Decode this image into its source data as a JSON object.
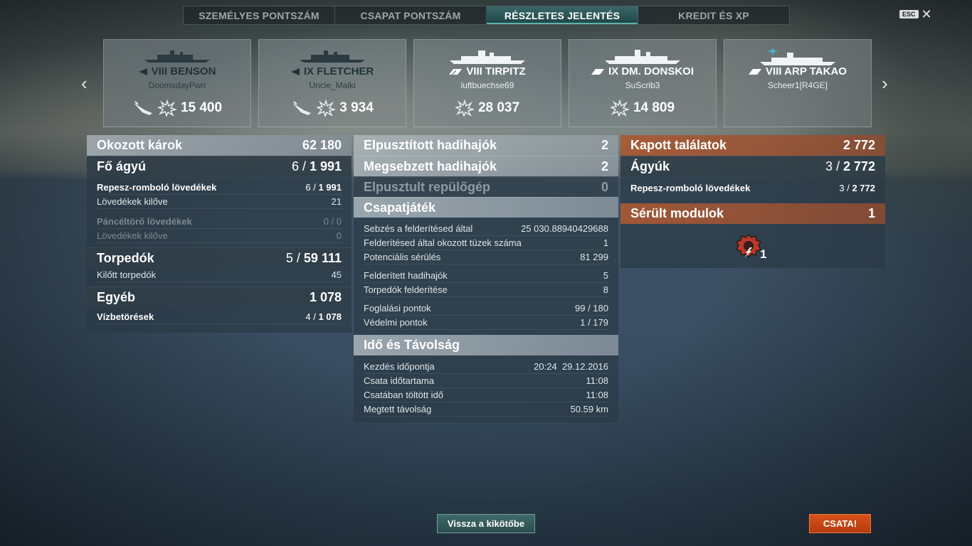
{
  "tabs": [
    {
      "label": "SZEMÉLYES PONTSZÁM"
    },
    {
      "label": "CSAPAT PONTSZÁM"
    },
    {
      "label": "RÉSZLETES JELENTÉS"
    },
    {
      "label": "KREDIT ÉS XP"
    }
  ],
  "active_tab": 2,
  "esc_label": "ESC",
  "ships": [
    {
      "name": "VIII BENSON",
      "player": "DoomsdayPwn",
      "damage": "15 400",
      "side": "enemy",
      "icons": [
        "torpedo-hit-icon",
        "explosion-icon"
      ]
    },
    {
      "name": "IX FLETCHER",
      "player": "Uncle_Malki",
      "damage": "3 934",
      "side": "enemy",
      "icons": [
        "torpedo-hit-icon",
        "explosion-icon"
      ]
    },
    {
      "name": "VIII TIRPITZ",
      "player": "luftbuechse69",
      "damage": "28 037",
      "side": "ally",
      "icons": [
        "explosion-icon"
      ]
    },
    {
      "name": "IX DM. DONSKOI",
      "player": "SuScrib3",
      "damage": "14 809",
      "side": "ally",
      "icons": [
        "explosion-icon"
      ]
    },
    {
      "name": "VIII ARP TAKAO",
      "player": "Scheer1[R4GE]",
      "damage": "",
      "side": "ally",
      "icons": []
    }
  ],
  "damage_panel": {
    "header": {
      "label": "Okozott károk",
      "value": "62 180"
    },
    "main_gun": {
      "label": "Fő ágyú",
      "value_a": "6 / ",
      "value_b": "1 991"
    },
    "he_shells": {
      "label": "Repesz-romboló lövedékek",
      "value_a": "6 / ",
      "value_b": "1 991"
    },
    "shells_fired": {
      "label": "Lövedékek kilőve",
      "value": "21"
    },
    "ap_shells": {
      "label": "Páncéltörő lövedékek",
      "value": "0 / 0"
    },
    "ap_fired": {
      "label": "Lövedékek kilőve",
      "value": "0"
    },
    "torpedoes": {
      "label": "Torpedók",
      "value_a": "5 / ",
      "value_b": "59 111"
    },
    "torps_fired": {
      "label": "Kilőtt torpedók",
      "value": "45"
    },
    "other": {
      "label": "Egyéb",
      "value": "1 078"
    },
    "flooding": {
      "label": "Vízbetörések",
      "value_a": "4 / ",
      "value_b": "1 078"
    }
  },
  "kills_panel": {
    "destroyed": {
      "label": "Elpusztított hadihajók",
      "value": "2"
    },
    "damaged": {
      "label": "Megsebzett hadihajók",
      "value": "2"
    },
    "planes": {
      "label": "Elpusztult repülőgép",
      "value": "0"
    },
    "teamplay_title": "Csapatjáték",
    "teamplay_rows": [
      {
        "label": "Sebzés a felderítésed által",
        "value": "25 030.88940429688"
      },
      {
        "label": "Felderítésed által okozott tüzek száma",
        "value": "1"
      },
      {
        "label": "Potenciális sérülés",
        "value": "81 299"
      },
      {
        "label": "Felderített hadihajók",
        "value": "5"
      },
      {
        "label": "Torpedók felderítése",
        "value": "8"
      },
      {
        "label": "Foglalási pontok",
        "value": "99 / 180"
      },
      {
        "label": "Védelmi pontok",
        "value": "1 / 179"
      }
    ],
    "time_title": "Idő és Távolság",
    "time_rows": [
      {
        "label": "Kezdés időpontja",
        "value": "20:24  29.12.2016"
      },
      {
        "label": "Csata időtartama",
        "value": "11:08"
      },
      {
        "label": "Csatában töltött idő",
        "value": "11:08"
      },
      {
        "label": "Megtett távolság",
        "value": "50.59 km"
      }
    ]
  },
  "received_panel": {
    "header": {
      "label": "Kapott találatok",
      "value": "2 772"
    },
    "guns": {
      "label": "Ágyúk",
      "value_a": "3 / ",
      "value_b": "2 772"
    },
    "he": {
      "label": "Repesz-romboló lövedékek",
      "value_a": "3 / ",
      "value_b": "2 772"
    },
    "modules": {
      "label": "Sérült modulok",
      "value": "1"
    },
    "module_icon": "damaged-engine-icon",
    "module_count": "1"
  },
  "buttons": {
    "port": "Vissza a kikötőbe",
    "battle": "CSATA!"
  },
  "colors": {
    "accent_teal": "#5fb3ad",
    "received_orange": "#aa5832",
    "battle_button": "#d8521b"
  }
}
